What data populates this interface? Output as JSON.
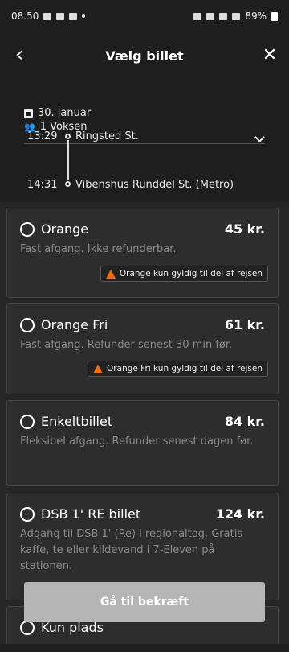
{
  "status": {
    "time": "08.50",
    "battery": "89%"
  },
  "header": {
    "title": "Vælg billet"
  },
  "trip": {
    "date": "30. januar",
    "passengers": "1 Voksen",
    "departure_time": "13:29",
    "departure_station": "Ringsted St.",
    "arrival_time": "14:31",
    "arrival_station": "Vibenshus Runddel St. (Metro)"
  },
  "tickets": [
    {
      "name": "Orange",
      "price": "45 kr.",
      "description": "Fast afgang. Ikke refunderbar.",
      "warning": "Orange kun gyldig til del af rejsen"
    },
    {
      "name": "Orange Fri",
      "price": "61 kr.",
      "description": "Fast afgang. Refunder senest 30 min før.",
      "warning": "Orange Fri kun gyldig til del af rejsen"
    },
    {
      "name": "Enkeltbillet",
      "price": "84 kr.",
      "description": "Fleksibel afgang. Refunder senest dagen før."
    },
    {
      "name": "DSB 1' RE billet",
      "price": "124 kr.",
      "description": "Adgang til DSB 1' (Re) i regionaltog. Gratis kaffe, te eller kildevand i 7-Eleven på stationen."
    },
    {
      "name": "Kun plads"
    }
  ],
  "confirm_button": "Gå til bekræft",
  "colors": {
    "warning_icon": "#ff6a00",
    "button_disabled": "#b5b5b5"
  }
}
